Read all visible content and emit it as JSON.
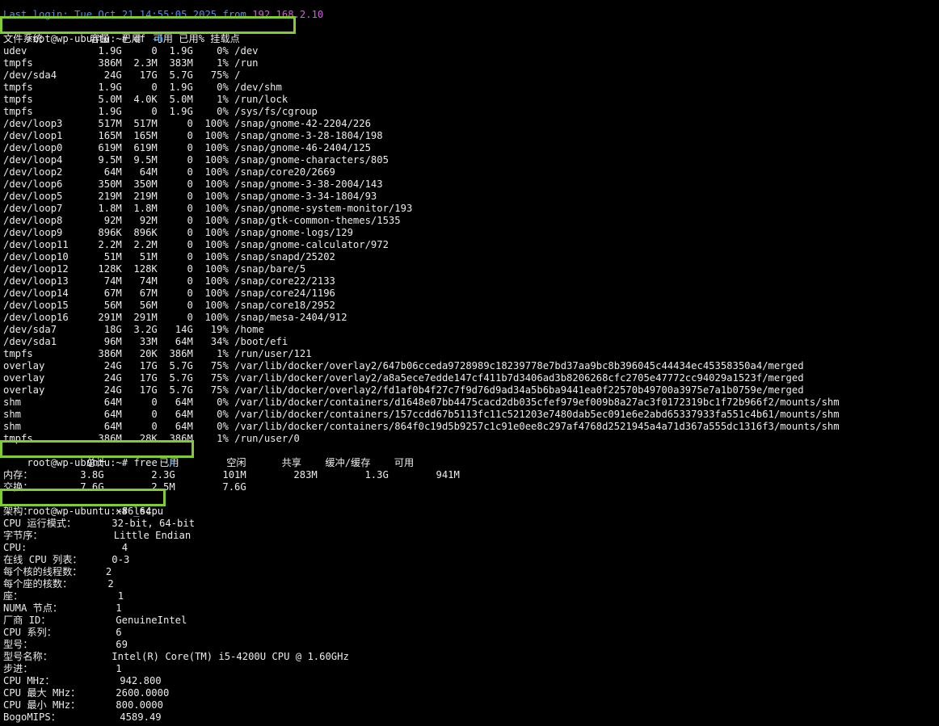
{
  "login": {
    "prefix": "Last login: Tue Oct 21 14:55:05 2025 from ",
    "ip_part1": "192",
    "ip_part2": ".168.2.10"
  },
  "prompt": "root@wp-ubuntu:~# ",
  "commands": {
    "df": {
      "name": "df",
      "flag": "-h"
    },
    "free": {
      "name": "free",
      "flag": "-h"
    },
    "lscpu": {
      "name": "lscpu"
    }
  },
  "df_output": [
    "文件系统        容量  已用  可用 已用% 挂载点",
    "udev            1.9G     0  1.9G    0% /dev",
    "tmpfs           386M  2.3M  383M    1% /run",
    "/dev/sda4        24G   17G  5.7G   75% /",
    "tmpfs           1.9G     0  1.9G    0% /dev/shm",
    "tmpfs           5.0M  4.0K  5.0M    1% /run/lock",
    "tmpfs           1.9G     0  1.9G    0% /sys/fs/cgroup",
    "/dev/loop3      517M  517M     0  100% /snap/gnome-42-2204/226",
    "/dev/loop1      165M  165M     0  100% /snap/gnome-3-28-1804/198",
    "/dev/loop0      619M  619M     0  100% /snap/gnome-46-2404/125",
    "/dev/loop4      9.5M  9.5M     0  100% /snap/gnome-characters/805",
    "/dev/loop2       64M   64M     0  100% /snap/core20/2669",
    "/dev/loop6      350M  350M     0  100% /snap/gnome-3-38-2004/143",
    "/dev/loop5      219M  219M     0  100% /snap/gnome-3-34-1804/93",
    "/dev/loop7      1.8M  1.8M     0  100% /snap/gnome-system-monitor/193",
    "/dev/loop8       92M   92M     0  100% /snap/gtk-common-themes/1535",
    "/dev/loop9      896K  896K     0  100% /snap/gnome-logs/129",
    "/dev/loop11     2.2M  2.2M     0  100% /snap/gnome-calculator/972",
    "/dev/loop10      51M   51M     0  100% /snap/snapd/25202",
    "/dev/loop12     128K  128K     0  100% /snap/bare/5",
    "/dev/loop13      74M   74M     0  100% /snap/core22/2133",
    "/dev/loop14      67M   67M     0  100% /snap/core24/1196",
    "/dev/loop15      56M   56M     0  100% /snap/core18/2952",
    "/dev/loop16     291M  291M     0  100% /snap/mesa-2404/912",
    "/dev/sda7        18G  3.2G   14G   19% /home",
    "/dev/sda1        96M   33M   64M   34% /boot/efi",
    "tmpfs           386M   20K  386M    1% /run/user/121",
    "overlay          24G   17G  5.7G   75% /var/lib/docker/overlay2/647b06cceda9728989c18239778e7bd37aa9bc8b396045c44434ec45358350a4/merged",
    "overlay          24G   17G  5.7G   75% /var/lib/docker/overlay2/a8a5ece7edde147cf411b7d3406ad3b8206268cfc2705e47772cc94029a1523f/merged",
    "overlay          24G   17G  5.7G   75% /var/lib/docker/overlay2/fd1af0b4f27c7f9d76d9ad34a5b6ba9441ea0f22570b49700a3975e7a1b0759e/merged",
    "shm              64M     0   64M    0% /var/lib/docker/containers/d1648e07bb4475cacd2db035cfef979ef009b8a27ac3f0172319bc1f72b966f2/mounts/shm",
    "shm              64M     0   64M    0% /var/lib/docker/containers/157ccdd67b5113fc11c521203e7480dab5ec091e6e2abd65337933fa551c4b61/mounts/shm",
    "shm              64M     0   64M    0% /var/lib/docker/containers/864f0c19d5b9257c1c91e0ee8c297af4768d2521945a4a71d367a555dc1316f3/mounts/shm",
    "tmpfs           386M   28K  386M    1% /run/user/0"
  ],
  "free_output": [
    "              总计         已用        空闲      共享    缓冲/缓存    可用",
    "内存：        3.8G        2.3G        101M        283M        1.3G        941M",
    "交换：        7.6G        2.5M        7.6G"
  ],
  "lscpu_output": [
    "架构：              x86_64",
    "CPU 运行模式：      32-bit, 64-bit",
    "字节序：            Little Endian",
    "CPU:                4",
    "在线 CPU 列表：     0-3",
    "每个核的线程数：    2",
    "每个座的核数：      2",
    "座：                1",
    "NUMA 节点：         1",
    "厂商 ID：           GenuineIntel",
    "CPU 系列：          6",
    "型号：              69",
    "型号名称：          Intel(R) Core(TM) i5-4200U CPU @ 1.60GHz",
    "步进：              1",
    "CPU MHz：           942.800",
    "CPU 最大 MHz：      2600.0000",
    "CPU 最小 MHz：      800.0000",
    "BogoMIPS：          4589.49"
  ],
  "colors": {
    "background": "#000000",
    "text": "#ececec",
    "highlight_box": "#82cc32",
    "login_blue": "#4e8df5",
    "ip_magenta": "#d35fe0",
    "flag_cyan": "#3fa9f5"
  }
}
